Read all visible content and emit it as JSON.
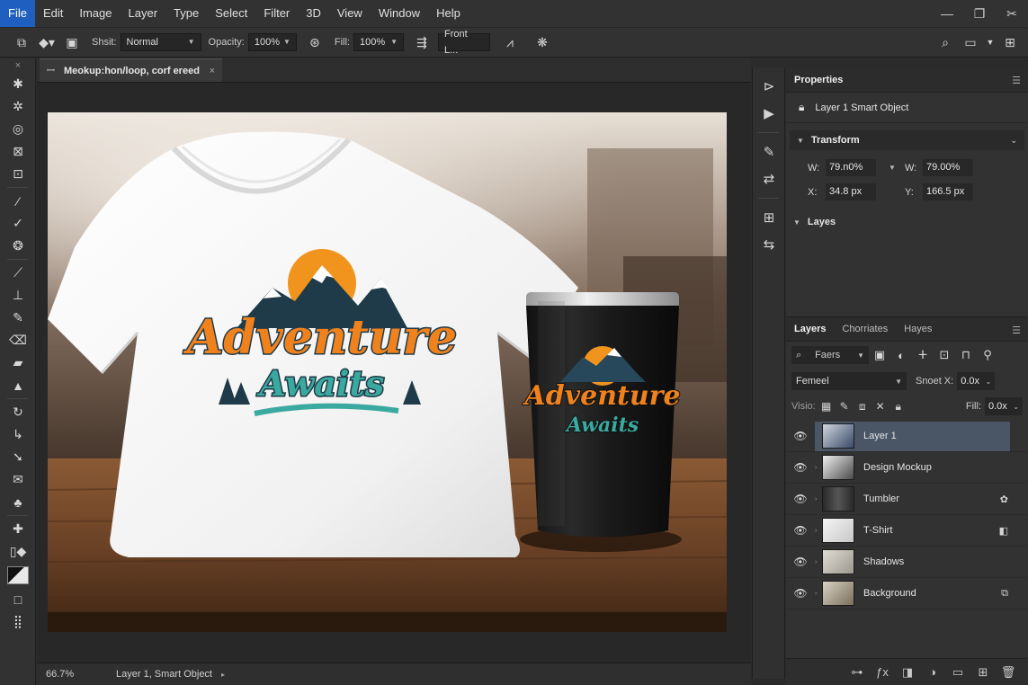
{
  "menu": [
    "File",
    "Edit",
    "Image",
    "Layer",
    "Type",
    "Select",
    "Filter",
    "3D",
    "View",
    "Window",
    "Help"
  ],
  "options_bar": {
    "mode_label": "Shsit:",
    "mode_value": "Normal",
    "opacity_label": "Opacity:",
    "opacity_value": "100%",
    "fill_label": "Fill:",
    "fill_value": "100%",
    "front_value": "Front L..."
  },
  "document": {
    "tab_title": "Meokup:hon/loop, corf ereed",
    "mockup": {
      "tshirt_line1": "Adventure",
      "tshirt_line2": "Awaits",
      "tumbler_line1": "Adventure",
      "tumbler_line2": "Awaits"
    }
  },
  "status": {
    "zoom": "66.7%",
    "info": "Layer 1, Smart Object"
  },
  "properties": {
    "title": "Properties",
    "layer_name": "Layer 1  Smart Object",
    "transform_title": "Transform",
    "w_label": "W:",
    "w_value": "79.n0%",
    "w2_label": "W:",
    "w2_value": "79.00%",
    "x_label": "X:",
    "x_value": "34.8 px",
    "y_label": "Y:",
    "y_value": "166.5 px",
    "layes_title": "Layes"
  },
  "layers_panel": {
    "tabs": [
      "Layers",
      "Chorriates",
      "Hayes"
    ],
    "filter_label": "Faers",
    "blend_mode": "Femeel",
    "snoet_label": "Snoet X:",
    "snoet_value": "0.0x",
    "lock_label": "Visio:",
    "fill_label": "Fill:",
    "fill_value": "0.0x",
    "layers": [
      {
        "name": "Layer 1",
        "selected": true
      },
      {
        "name": "Design Mockup",
        "selected": false
      },
      {
        "name": "Tumbler",
        "selected": false
      },
      {
        "name": "T-Shirt",
        "selected": false
      },
      {
        "name": "Shadows",
        "selected": false
      },
      {
        "name": "Background",
        "selected": false
      }
    ]
  },
  "colors": {
    "accent_blue": "#1f5fbf",
    "selected_layer": "#4a5566",
    "design_orange": "#f0821e",
    "design_teal": "#3aa99f"
  }
}
